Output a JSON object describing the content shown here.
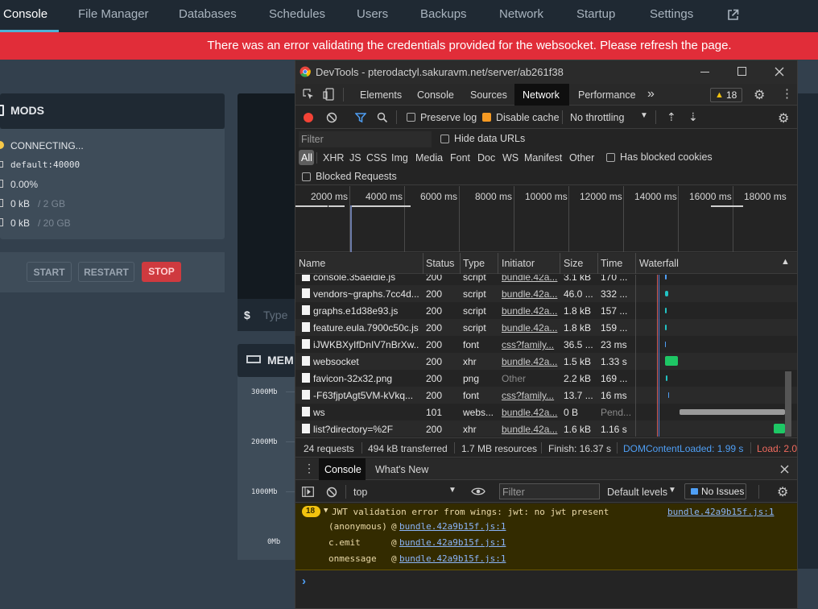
{
  "nav": {
    "tabs": [
      "Console",
      "File Manager",
      "Databases",
      "Schedules",
      "Users",
      "Backups",
      "Network",
      "Startup",
      "Settings"
    ]
  },
  "error_banner": "There was an error validating the credentials provided for the websocket. Please refresh the page.",
  "server": {
    "title": "MODS",
    "status": "CONNECTING...",
    "address": "default:40000",
    "cpu": "0.00%",
    "memory_used": "0 kB",
    "memory_limit": "/ 2 GB",
    "disk_used": "0 kB",
    "disk_limit": "/ 20 GB"
  },
  "power": {
    "start": "START",
    "restart": "RESTART",
    "stop": "STOP"
  },
  "terminal": {
    "prompt": "$",
    "placeholder": "Type"
  },
  "memory_chart": {
    "title": "MEM",
    "ticks": [
      "3000Mb",
      "2000Mb",
      "1000Mb",
      "0Mb"
    ]
  },
  "devtools": {
    "window_title": "DevTools - pterodactyl.sakuravm.net/server/ab261f38",
    "tabs": [
      "Elements",
      "Console",
      "Sources",
      "Network",
      "Performance"
    ],
    "more": "»",
    "warning_count": "18",
    "preserve_log": "Preserve log",
    "disable_cache": "Disable cache",
    "throttling": "No throttling",
    "filter_placeholder": "Filter",
    "hide_data_urls": "Hide data URLs",
    "types": [
      "All",
      "XHR",
      "JS",
      "CSS",
      "Img",
      "Media",
      "Font",
      "Doc",
      "WS",
      "Manifest",
      "Other"
    ],
    "has_blocked_cookies": "Has blocked cookies",
    "blocked_requests": "Blocked Requests",
    "timeline_ticks": [
      "2000 ms",
      "4000 ms",
      "6000 ms",
      "8000 ms",
      "10000 ms",
      "12000 ms",
      "14000 ms",
      "16000 ms",
      "18000 ms"
    ],
    "columns": [
      "Name",
      "Status",
      "Type",
      "Initiator",
      "Size",
      "Time",
      "Waterfall"
    ],
    "rows": [
      {
        "name": "console.35aeldle.js",
        "status": "200",
        "type": "script",
        "initiator": "bundle.42a...",
        "size": "3.1 kB",
        "time": "170 ..."
      },
      {
        "name": "vendors~graphs.7cc4d...",
        "status": "200",
        "type": "script",
        "initiator": "bundle.42a...",
        "size": "46.0 ...",
        "time": "332 ..."
      },
      {
        "name": "graphs.e1d38e93.js",
        "status": "200",
        "type": "script",
        "initiator": "bundle.42a...",
        "size": "1.8 kB",
        "time": "157 ..."
      },
      {
        "name": "feature.eula.7900c50c.js",
        "status": "200",
        "type": "script",
        "initiator": "bundle.42a...",
        "size": "1.8 kB",
        "time": "159 ..."
      },
      {
        "name": "iJWKBXyIfDnIV7nBrXw...",
        "status": "200",
        "type": "font",
        "initiator": "css?family...",
        "size": "36.5 ...",
        "time": "23 ms"
      },
      {
        "name": "websocket",
        "status": "200",
        "type": "xhr",
        "initiator": "bundle.42a...",
        "size": "1.5 kB",
        "time": "1.33 s"
      },
      {
        "name": "favicon-32x32.png",
        "status": "200",
        "type": "png",
        "initiator": "Other",
        "size": "2.2 kB",
        "time": "169 ..."
      },
      {
        "name": "-F63fjptAgt5VM-kVkq...",
        "status": "200",
        "type": "font",
        "initiator": "css?family...",
        "size": "13.7 ...",
        "time": "16 ms"
      },
      {
        "name": "ws",
        "status": "101",
        "type": "webs...",
        "initiator": "bundle.42a...",
        "size": "0 B",
        "time": "Pend..."
      },
      {
        "name": "list?directory=%2F",
        "status": "200",
        "type": "xhr",
        "initiator": "bundle.42a...",
        "size": "1.6 kB",
        "time": "1.16 s"
      }
    ],
    "summary": {
      "requests": "24 requests",
      "transferred": "494 kB transferred",
      "resources": "1.7 MB resources",
      "finish": "Finish: 16.37 s",
      "dom": "DOMContentLoaded: 1.99 s",
      "load": "Load: 2.0"
    },
    "drawer_tabs": [
      "Console",
      "What's New"
    ],
    "context": "top",
    "console_filter_placeholder": "Filter",
    "levels": "Default levels",
    "issues": "No Issues",
    "console_count": "18",
    "console_message": "JWT validation error from wings: jwt: no jwt present",
    "console_source": "bundle.42a9b15f.js:1",
    "stack": [
      {
        "fn": "(anonymous)",
        "at": "@",
        "link": "bundle.42a9b15f.js:1"
      },
      {
        "fn": "c.emit",
        "at": "@",
        "link": "bundle.42a9b15f.js:1"
      },
      {
        "fn": "onmessage",
        "at": "@",
        "link": "bundle.42a9b15f.js:1"
      }
    ],
    "prompt": "›"
  }
}
